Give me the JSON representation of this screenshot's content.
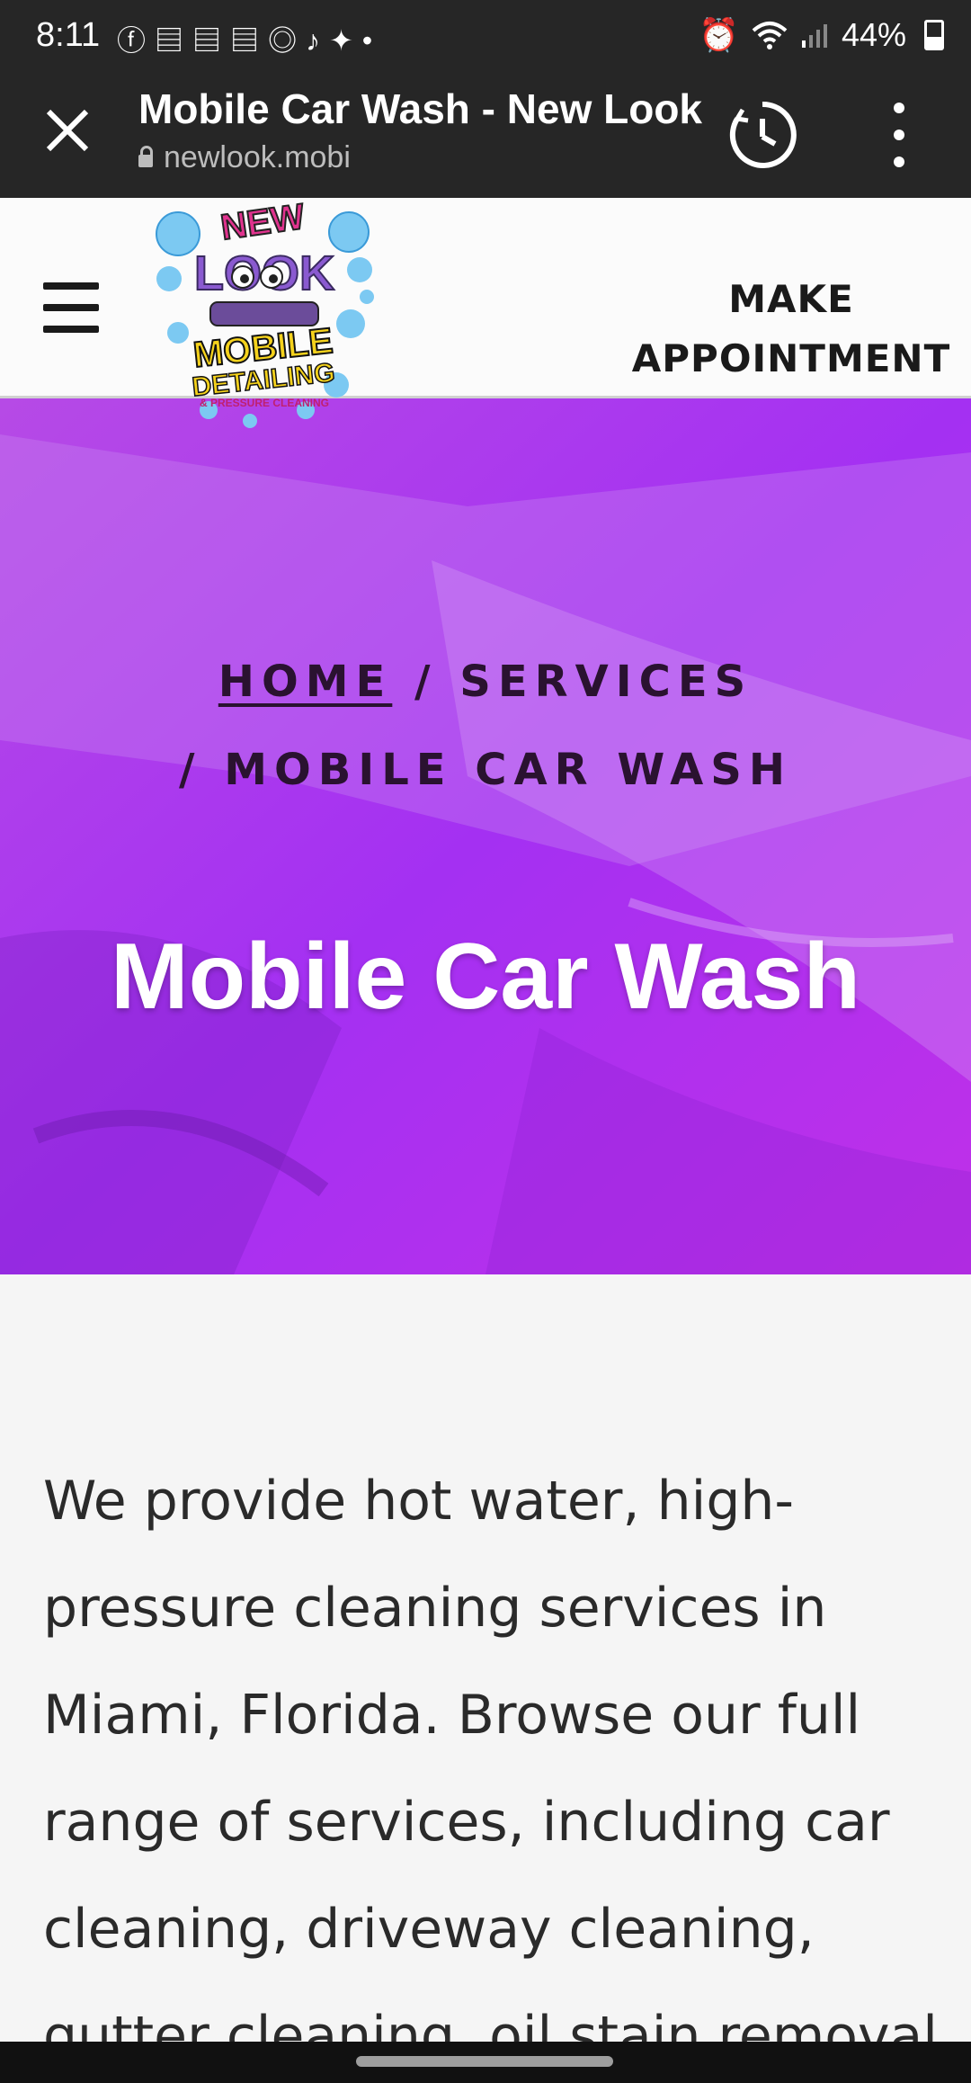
{
  "status_bar": {
    "time": "8:11",
    "left_icons": [
      "facebook-icon",
      "newspaper-icon",
      "newspaper-icon",
      "newspaper-icon",
      "instagram-icon",
      "tiktok-icon",
      "twitter-icon",
      "dot-icon"
    ],
    "battery": "44%"
  },
  "browser": {
    "title": "Mobile Car Wash - New Look",
    "url": "newlook.mobi"
  },
  "header": {
    "logo_text_top": "NEW",
    "logo_text_look": "LOOK",
    "logo_text_mobile": "MOBILE",
    "logo_text_detailing": "DETAILING",
    "logo_text_pressure": "& PRESSURE CLEANING",
    "appointment_line1": "MAKE",
    "appointment_line2": "APPOINTMENT"
  },
  "hero": {
    "breadcrumb_home": "HOME",
    "breadcrumb_sep1": " / ",
    "breadcrumb_services": "SERVICES",
    "breadcrumb_sep2": "/ ",
    "breadcrumb_current": "MOBILE CAR WASH",
    "title": "Mobile Car Wash"
  },
  "content": {
    "paragraph": "We provide hot water, high-pressure cleaning services in Miami, Florida. Browse our full range of services, including car cleaning, driveway cleaning, gutter cleaning, oil stain removal"
  },
  "colors": {
    "browser_bg": "#262626",
    "hero_purple": "#a12ff0",
    "page_bg": "#f5f5f5"
  }
}
